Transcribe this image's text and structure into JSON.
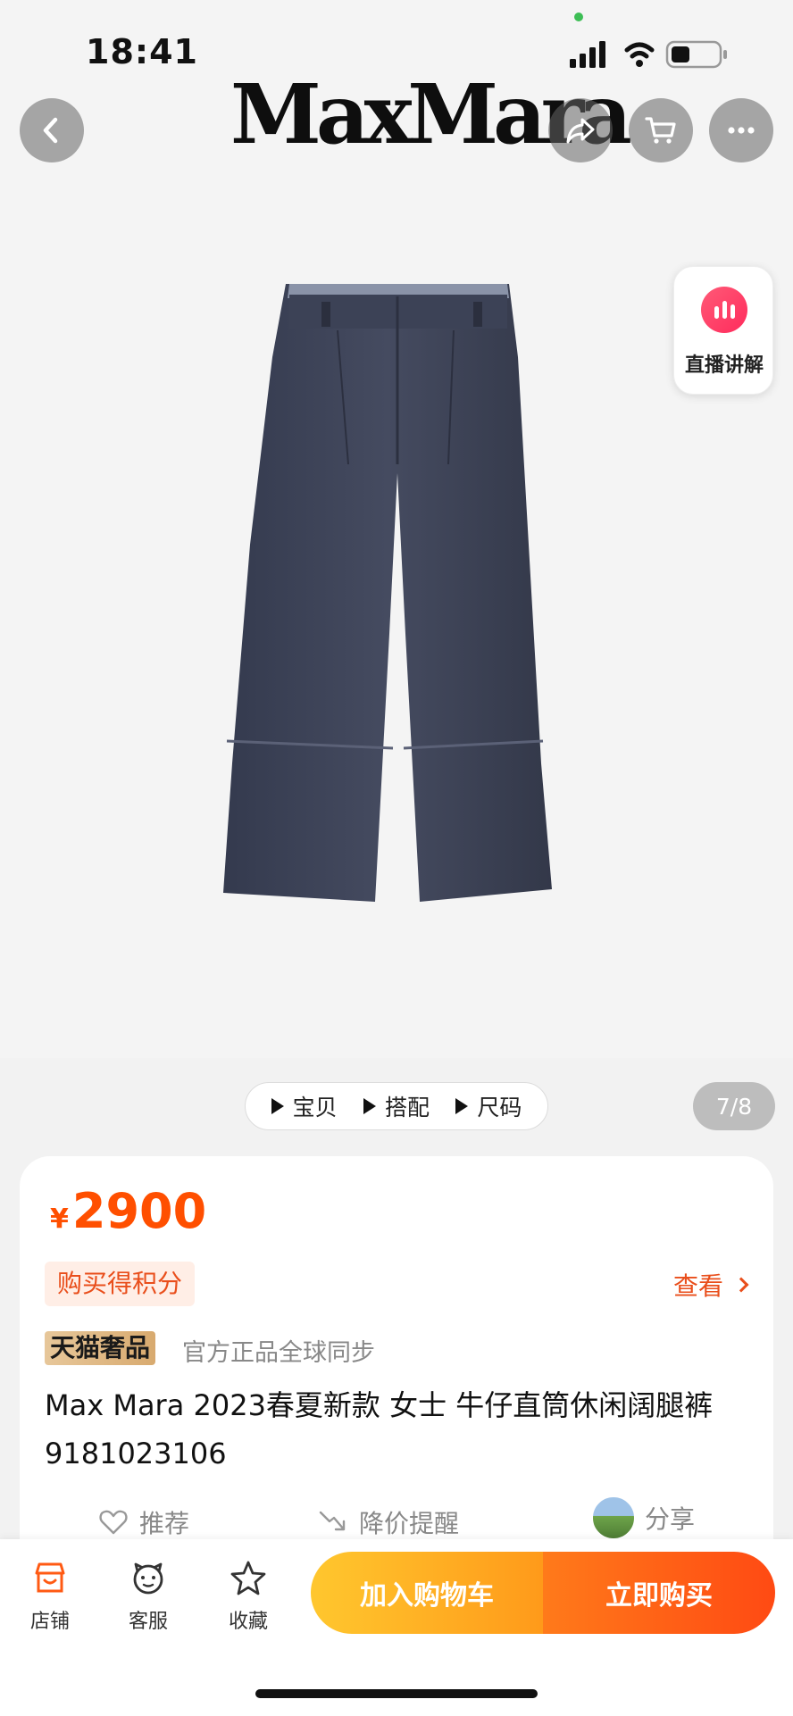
{
  "status_bar": {
    "time": "18:41"
  },
  "header": {
    "brand": "MaxMara"
  },
  "icons": {
    "back": "chevron-left-icon",
    "share": "share-arrow-icon",
    "cart": "shopping-cart-icon",
    "more": "more-dots-icon"
  },
  "live": {
    "label": "直播讲解"
  },
  "gallery": {
    "tabs": [
      "宝贝",
      "搭配",
      "尺码"
    ],
    "pager": "7/8"
  },
  "product": {
    "currency": "¥",
    "price": "2900",
    "points_label": "购买得积分",
    "view_label": "查看",
    "badge": "天猫奢品",
    "official": "官方正品全球同步",
    "title": "Max Mara 2023春夏新款 女士 牛仔直筒休闲阔腿裤9181023106"
  },
  "actions": {
    "recommend": "推荐",
    "price_alert": "降价提醒",
    "share": "分享"
  },
  "bottom_bar": {
    "store": "店铺",
    "service": "客服",
    "favorite": "收藏",
    "add_to_cart": "加入购物车",
    "buy_now": "立即购买"
  },
  "colors": {
    "accent": "#ff4f00",
    "cart_button": "#ffb020",
    "buy_button": "#ff5a13",
    "denim": "#3a3f52"
  }
}
